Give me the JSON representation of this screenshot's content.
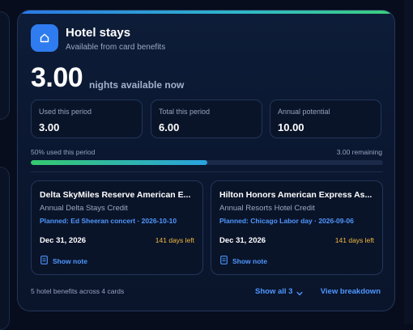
{
  "header": {
    "title": "Hotel stays",
    "subtitle": "Available from card benefits",
    "icon": "home-icon",
    "icon_bg": "#2f7cf0"
  },
  "summary": {
    "value": "3.00",
    "caption": "nights available now"
  },
  "stats": [
    {
      "label": "Used this period",
      "value": "3.00"
    },
    {
      "label": "Total this period",
      "value": "6.00"
    },
    {
      "label": "Annual potential",
      "value": "10.00"
    }
  ],
  "progress": {
    "left_label": "50% used this period",
    "right_label": "3.00 remaining",
    "fraction": 0.5,
    "colors": [
      "#35c96f",
      "#2aa2e0"
    ]
  },
  "benefits": [
    {
      "name": "Delta SkyMiles Reserve American E...",
      "credit": "Annual Delta Stays Credit",
      "planned": "Planned: Ed Sheeran concert · 2026-10-10",
      "date": "Dec 31, 2026",
      "days_left": "141 days left",
      "note_label": "Show note"
    },
    {
      "name": "Hilton Honors American Express As...",
      "credit": "Annual Resorts Hotel Credit",
      "planned": "Planned: Chicago Labor day · 2026-09-06",
      "date": "Dec 31, 2026",
      "days_left": "141 days left",
      "note_label": "Show note"
    }
  ],
  "footer": {
    "summary": "5 hotel benefits across 4 cards",
    "show_all": "Show all 3",
    "breakdown": "View breakdown"
  },
  "colors": {
    "accent": "#4f97ff",
    "warning": "#f0b73c",
    "card_bg": "#0b1730"
  }
}
